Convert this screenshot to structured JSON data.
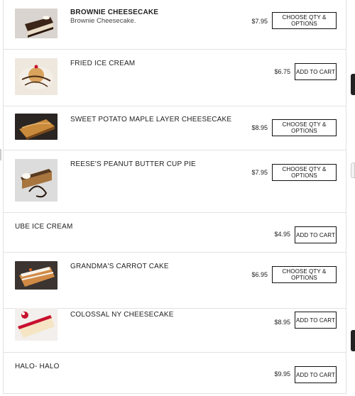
{
  "menu": {
    "items": [
      {
        "title": "BROWNIE CHEESECAKE",
        "description": "Brownie Cheesecake.",
        "price": "$7.95",
        "button": "CHOOSE QTY & OPTIONS",
        "image": "brownie-cheesecake-image"
      },
      {
        "title": "FRIED ICE CREAM",
        "price": "$6.75",
        "button": "ADD TO CART",
        "image": "fried-ice-cream-image"
      },
      {
        "title": "SWEET POTATO MAPLE LAYER CHEESECAKE",
        "price": "$8.95",
        "button": "CHOOSE QTY & OPTIONS",
        "image": "sweet-potato-cheesecake-image"
      },
      {
        "title": "REESE'S PEANUT BUTTER CUP PIE",
        "price": "$7.95",
        "button": "CHOOSE QTY & OPTIONS",
        "image": "peanut-butter-pie-image"
      },
      {
        "title": "UBE ICE CREAM",
        "price": "$4.95",
        "button": "ADD TO CART"
      },
      {
        "title": "GRANDMA'S CARROT CAKE",
        "price": "$6.95",
        "button": "CHOOSE QTY & OPTIONS",
        "image": "carrot-cake-image"
      },
      {
        "title": "COLOSSAL NY CHEESECAKE",
        "price": "$8.95",
        "button": "ADD TO CART",
        "image": "ny-cheesecake-image"
      },
      {
        "title": "HALO- HALO",
        "price": "$9.95",
        "button": "ADD TO CART"
      }
    ]
  },
  "colors": {
    "border": "#e2e2e2",
    "button_border": "#111111",
    "text": "#222222"
  }
}
